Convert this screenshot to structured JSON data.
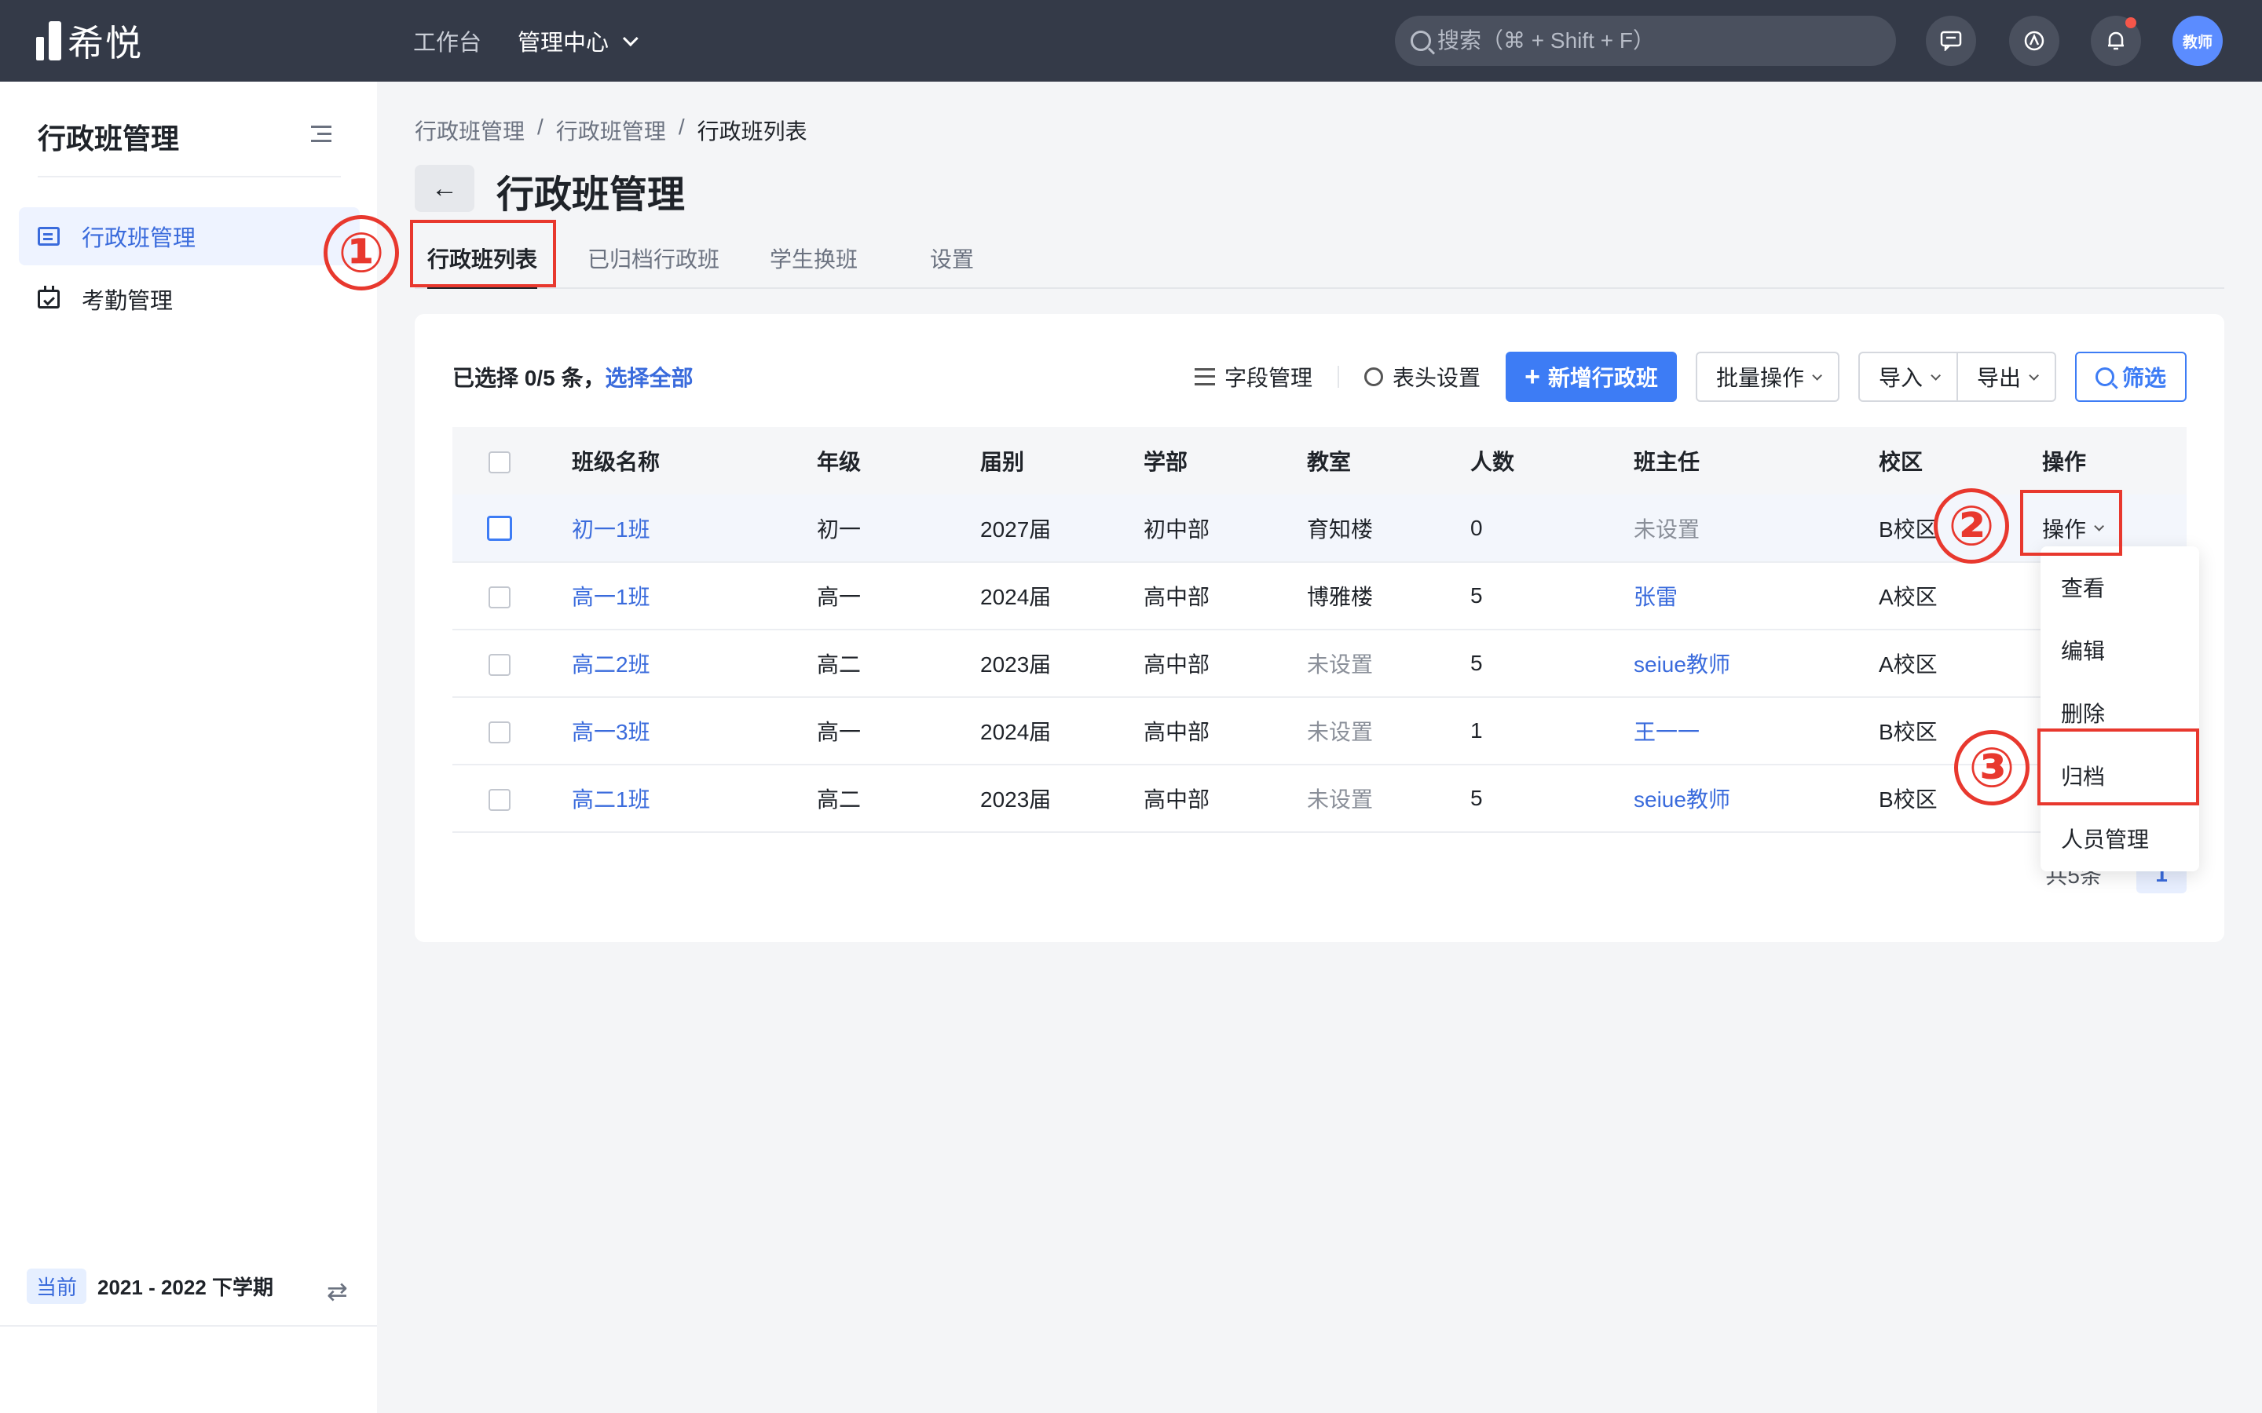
{
  "app": {
    "logo_text": "希悦"
  },
  "topnav": {
    "items": [
      "工作台"
    ],
    "active": "管理中心"
  },
  "search": {
    "placeholder": "搜索（⌘ + Shift + F）"
  },
  "avatar": {
    "label": "教师"
  },
  "sidebar": {
    "title": "行政班管理",
    "items": [
      {
        "label": "行政班管理",
        "icon": "list-icon",
        "active": true
      },
      {
        "label": "考勤管理",
        "icon": "calendar-icon",
        "active": false
      }
    ],
    "term_badge": "当前",
    "term": "2021 - 2022 下学期"
  },
  "breadcrumb": [
    "行政班管理",
    "/",
    "行政班管理",
    "/",
    "行政班列表"
  ],
  "page_title": "行政班管理",
  "tabs": [
    "行政班列表",
    "已归档行政班",
    "学生换班",
    "设置"
  ],
  "toolbar": {
    "selection": "已选择 0/5 条，",
    "select_all": "选择全部",
    "field_manage": "字段管理",
    "header_settings": "表头设置",
    "add_class": "新增行政班",
    "batch": "批量操作",
    "import": "导入",
    "export": "导出",
    "filter": "筛选"
  },
  "table": {
    "columns": [
      "班级名称",
      "年级",
      "届别",
      "学部",
      "教室",
      "人数",
      "班主任",
      "校区",
      "操作"
    ],
    "rows": [
      [
        "初一1班",
        "初一",
        "2027届",
        "初中部",
        "育知楼",
        "0",
        "未设置",
        "B校区",
        "操作"
      ],
      [
        "高一1班",
        "高一",
        "2024届",
        "高中部",
        "博雅楼",
        "5",
        "张雷",
        "A校区",
        ""
      ],
      [
        "高二2班",
        "高二",
        "2023届",
        "高中部",
        "未设置",
        "5",
        "seiue教师",
        "A校区",
        ""
      ],
      [
        "高一3班",
        "高一",
        "2024届",
        "高中部",
        "未设置",
        "1",
        "王一一",
        "B校区",
        ""
      ],
      [
        "高二1班",
        "高二",
        "2023届",
        "高中部",
        "未设置",
        "5",
        "seiue教师",
        "B校区",
        ""
      ]
    ]
  },
  "pager": {
    "total": "共5条",
    "page": "1"
  },
  "dropdown": [
    "查看",
    "编辑",
    "删除",
    "归档",
    "人员管理"
  ],
  "annotations": [
    "①",
    "②",
    "③"
  ],
  "colors": {
    "accent": "#3d7cf5",
    "annotation": "#e8382e",
    "topbar": "#343a48"
  }
}
